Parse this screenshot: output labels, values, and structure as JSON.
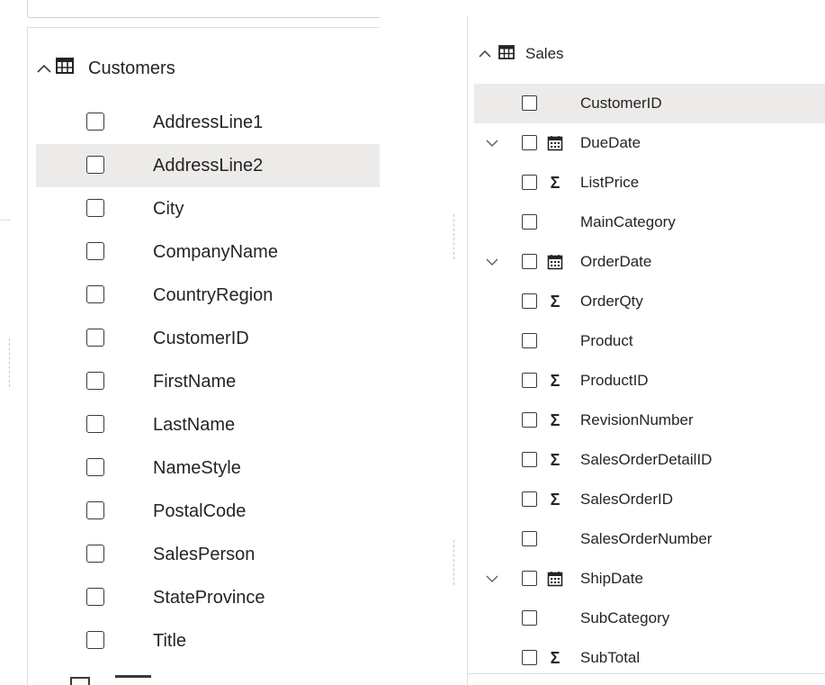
{
  "left_panel": {
    "table": {
      "name": "Customers",
      "expand_icon": "chevron-up-icon",
      "table_icon": "table-icon",
      "fields": [
        {
          "label": "AddressLine1"
        },
        {
          "label": "AddressLine2"
        },
        {
          "label": "City"
        },
        {
          "label": "CompanyName"
        },
        {
          "label": "CountryRegion"
        },
        {
          "label": "CustomerID"
        },
        {
          "label": "FirstName"
        },
        {
          "label": "LastName"
        },
        {
          "label": "NameStyle"
        },
        {
          "label": "PostalCode"
        },
        {
          "label": "SalesPerson"
        },
        {
          "label": "StateProvince"
        },
        {
          "label": "Title"
        }
      ]
    }
  },
  "right_panel": {
    "table": {
      "name": "Sales",
      "expand_icon": "chevron-up-icon",
      "table_icon": "table-icon",
      "fields": [
        {
          "label": "CustomerID",
          "type": "none",
          "expandable": false
        },
        {
          "label": "DueDate",
          "type": "calendar",
          "expandable": true
        },
        {
          "label": "ListPrice",
          "type": "sigma",
          "expandable": false
        },
        {
          "label": "MainCategory",
          "type": "none",
          "expandable": false
        },
        {
          "label": "OrderDate",
          "type": "calendar",
          "expandable": true
        },
        {
          "label": "OrderQty",
          "type": "sigma",
          "expandable": false
        },
        {
          "label": "Product",
          "type": "none",
          "expandable": false
        },
        {
          "label": "ProductID",
          "type": "sigma",
          "expandable": false
        },
        {
          "label": "RevisionNumber",
          "type": "sigma",
          "expandable": false
        },
        {
          "label": "SalesOrderDetailID",
          "type": "sigma",
          "expandable": false
        },
        {
          "label": "SalesOrderID",
          "type": "sigma",
          "expandable": false
        },
        {
          "label": "SalesOrderNumber",
          "type": "none",
          "expandable": false
        },
        {
          "label": "ShipDate",
          "type": "calendar",
          "expandable": true
        },
        {
          "label": "SubCategory",
          "type": "none",
          "expandable": false
        },
        {
          "label": "SubTotal",
          "type": "sigma",
          "expandable": false
        }
      ]
    }
  },
  "colors": {
    "hover_row": "#edebe9",
    "text": "#252423",
    "divider": "#e1dfdd"
  },
  "glyphs": {
    "sigma": "Σ"
  }
}
